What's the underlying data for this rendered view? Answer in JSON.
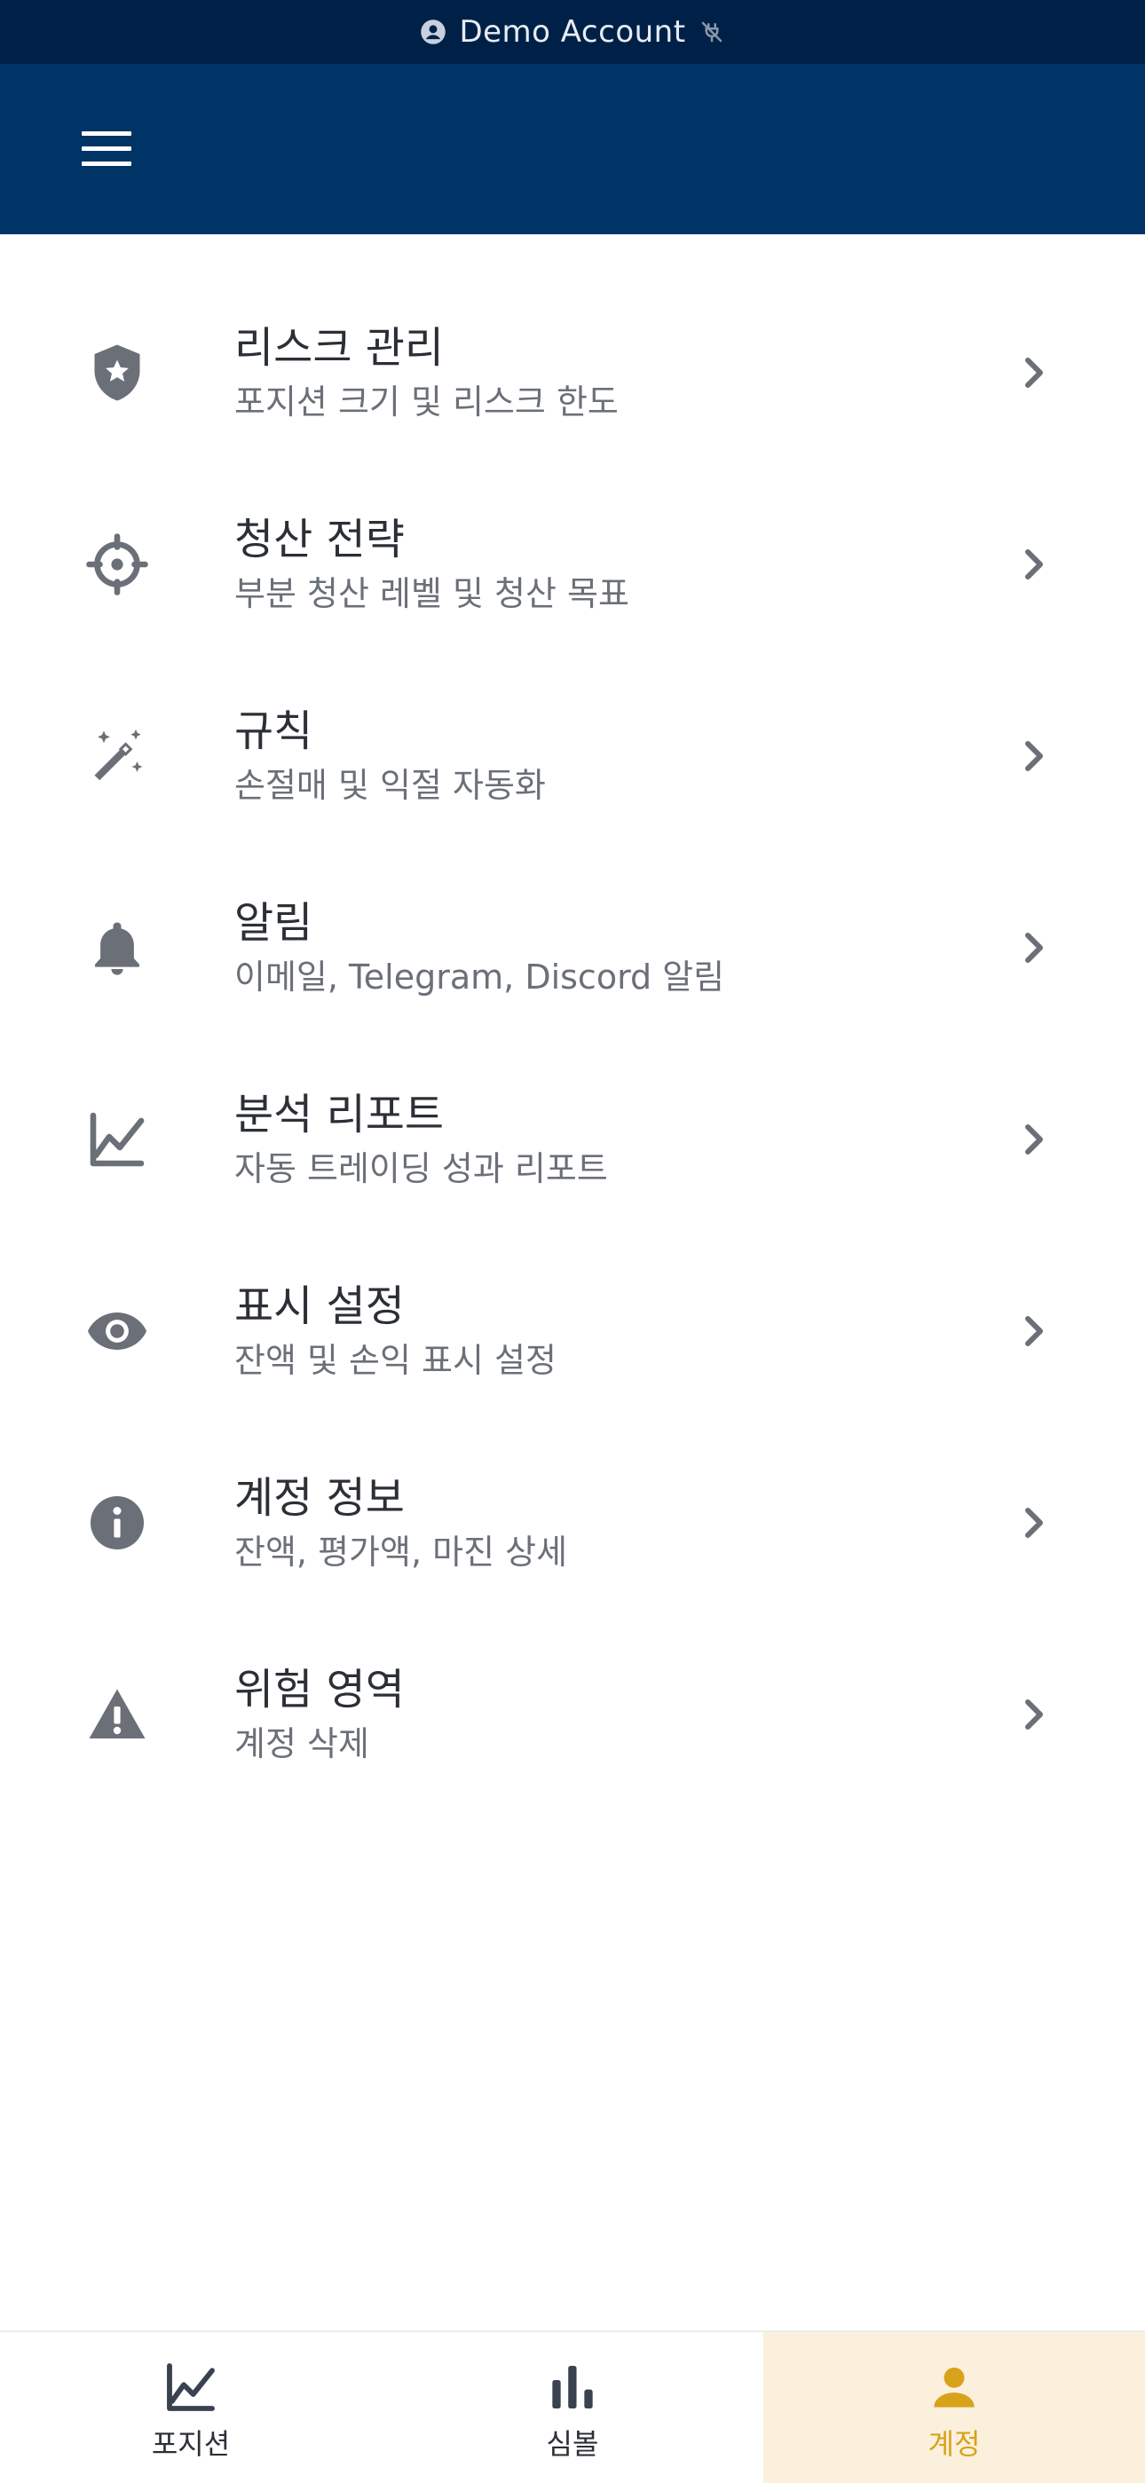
{
  "status_bar": {
    "label": "Demo Account",
    "account_icon": "account-circle-icon",
    "connection_icon": "link-off-icon"
  },
  "app_bar": {
    "menu_icon": "hamburger-menu-icon"
  },
  "menu": {
    "items": [
      {
        "title": "리스크 관리",
        "subtitle": "포지션 크기 및 리스크 한도",
        "icon": "shield-star-icon"
      },
      {
        "title": "청산 전략",
        "subtitle": "부분 청산 레벨 및 청산 목표",
        "icon": "crosshair-icon"
      },
      {
        "title": "규칙",
        "subtitle": "손절매 및 익절 자동화",
        "icon": "magic-wand-icon"
      },
      {
        "title": "알림",
        "subtitle": "이메일, Telegram, Discord 알림",
        "icon": "bell-icon"
      },
      {
        "title": "분석 리포트",
        "subtitle": "자동 트레이딩 성과 리포트",
        "icon": "line-chart-icon"
      },
      {
        "title": "표시 설정",
        "subtitle": "잔액 및 손익 표시 설정",
        "icon": "eye-icon"
      },
      {
        "title": "계정 정보",
        "subtitle": "잔액, 평가액, 마진 상세",
        "icon": "info-icon"
      },
      {
        "title": "위험 영역",
        "subtitle": "계정 삭제",
        "icon": "warning-icon"
      }
    ]
  },
  "bottom_nav": {
    "tabs": [
      {
        "label": "포지션",
        "icon": "line-chart-icon",
        "active": false
      },
      {
        "label": "심볼",
        "icon": "bar-chart-icon",
        "active": false
      },
      {
        "label": "계정",
        "icon": "person-icon",
        "active": true
      }
    ]
  },
  "colors": {
    "status_bar_bg": "#002147",
    "app_bar_bg": "#003366",
    "icon_gray": "#6b7078",
    "title_text": "#2b2f36",
    "active_tab_bg": "#faf0dc",
    "active_accent": "#d9a21b"
  }
}
